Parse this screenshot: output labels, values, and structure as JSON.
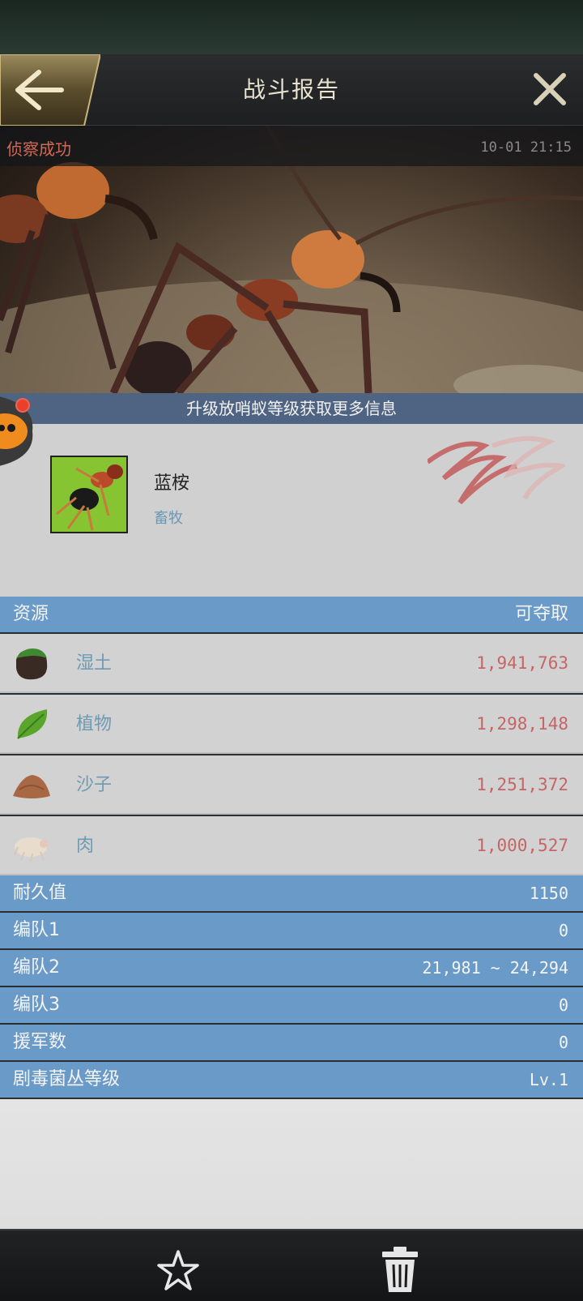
{
  "header": {
    "title": "战斗报告"
  },
  "report": {
    "status": "侦察成功",
    "time": "10-01 21:15",
    "upgrade_hint": "升级放哨蚁等级获取更多信息"
  },
  "target": {
    "name": "蓝桉",
    "type": "畜牧"
  },
  "resources": {
    "header_left": "资源",
    "header_right": "可夺取",
    "items": [
      {
        "name": "湿土",
        "amount": "1,941,763",
        "icon": "soil-icon"
      },
      {
        "name": "植物",
        "amount": "1,298,148",
        "icon": "leaf-icon"
      },
      {
        "name": "沙子",
        "amount": "1,251,372",
        "icon": "sand-icon"
      },
      {
        "name": "肉",
        "amount": "1,000,527",
        "icon": "meat-icon"
      }
    ]
  },
  "stats": [
    {
      "label": "耐久值",
      "value": "1150"
    },
    {
      "label": "编队1",
      "value": "0"
    },
    {
      "label": "编队2",
      "value": "21,981 ~ 24,294"
    },
    {
      "label": "编队3",
      "value": "0"
    },
    {
      "label": "援军数",
      "value": "0"
    },
    {
      "label": "剧毒菌丛等级",
      "value": "Lv.1"
    }
  ],
  "colors": {
    "header_bg": "#1d1f21",
    "section_blue": "#6a9ac7",
    "upgrade_bar": "#4e6482",
    "amount_red": "#c46666",
    "name_blue": "#6e9ab4",
    "status_red": "#d06a58"
  },
  "icons": {
    "back": "back-arrow-icon",
    "close": "close-icon",
    "favorite": "star-icon",
    "delete": "trash-icon"
  }
}
